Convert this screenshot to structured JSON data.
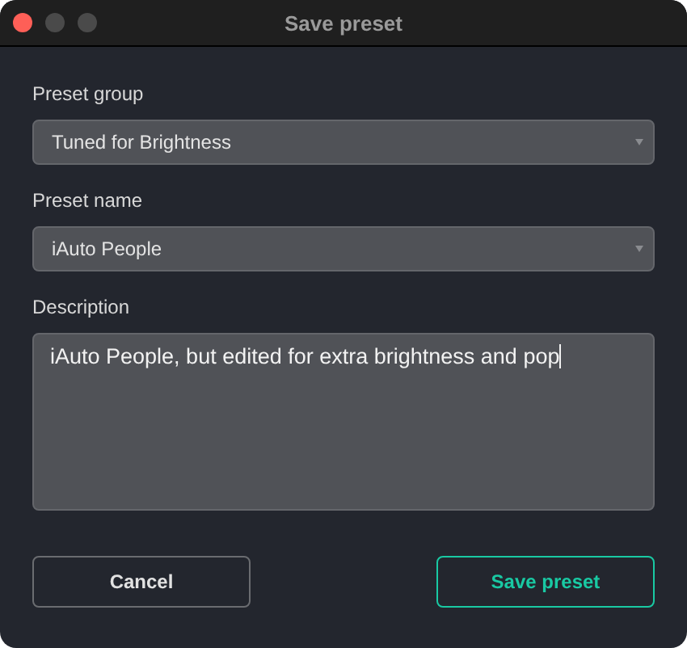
{
  "window": {
    "title": "Save preset"
  },
  "fields": [
    {
      "kind": "select",
      "label": "Preset group",
      "value": "Tuned for Brightness"
    },
    {
      "kind": "select",
      "label": "Preset name",
      "value": "iAuto People"
    },
    {
      "kind": "textarea",
      "label": "Description",
      "value": "iAuto People, but edited for extra brightness and pop"
    }
  ],
  "buttons": [
    {
      "label": "Cancel",
      "kind": "secondary"
    },
    {
      "label": "Save preset",
      "kind": "primary"
    }
  ]
}
